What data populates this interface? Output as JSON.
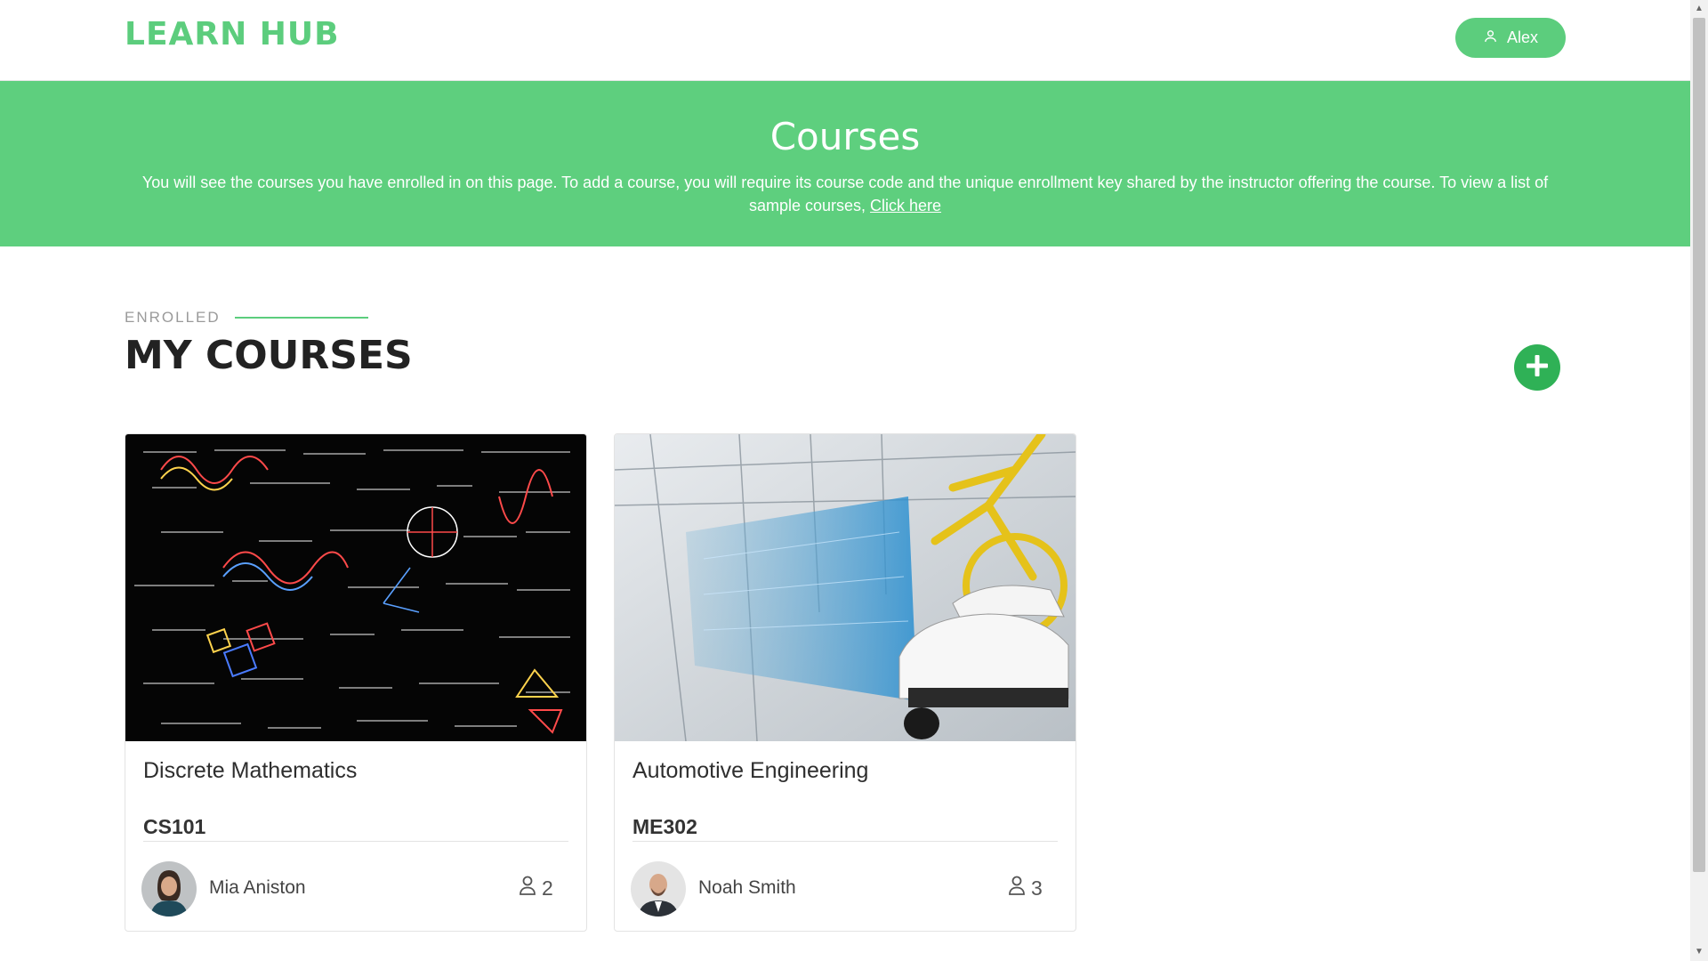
{
  "header": {
    "logo": "LEARN HUB",
    "user_name": "Alex"
  },
  "hero": {
    "title": "Courses",
    "description": "You will see the courses you have enrolled in on this page. To add a course, you will require its course code and the unique enrollment key shared by the instructor offering the course. To view a list of sample courses,",
    "link_text": "Click here"
  },
  "section": {
    "eyebrow": "ENROLLED",
    "title": "MY COURSES"
  },
  "courses": [
    {
      "title": "Discrete Mathematics",
      "code": "CS101",
      "instructor": "Mia Aniston",
      "students": "2"
    },
    {
      "title": "Automotive Engineering",
      "code": "ME302",
      "instructor": "Noah Smith",
      "students": "3"
    }
  ],
  "colors": {
    "brand": "#5ccd7d",
    "hero_bg": "#5ecf7e",
    "add_button": "#2fb156"
  },
  "icons": [
    "user-icon",
    "plus-icon"
  ]
}
